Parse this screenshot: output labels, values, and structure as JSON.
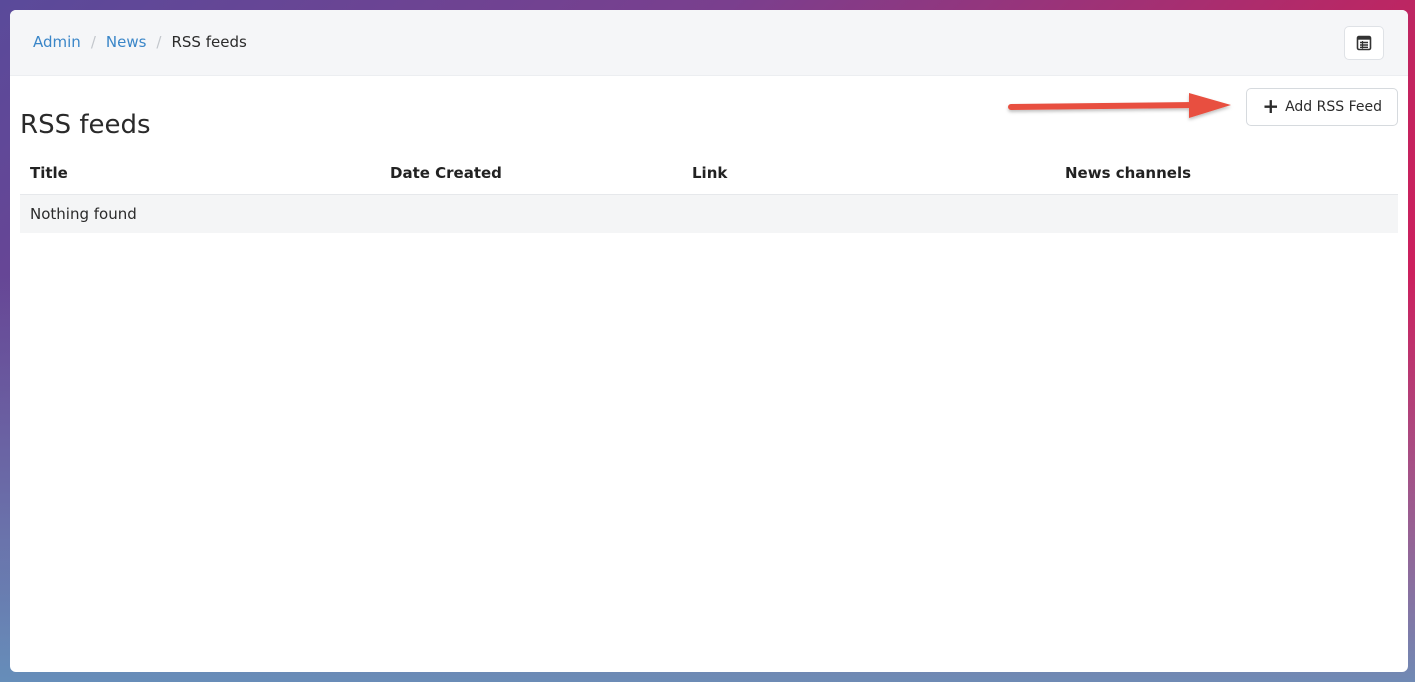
{
  "breadcrumb": {
    "items": [
      {
        "label": "Admin"
      },
      {
        "label": "News"
      }
    ],
    "current": "RSS feeds"
  },
  "page": {
    "title": "RSS feeds",
    "add_button_label": "Add RSS Feed"
  },
  "table": {
    "columns": [
      "Title",
      "Date Created",
      "Link",
      "News channels"
    ],
    "empty_message": "Nothing found"
  },
  "annotation": {
    "arrow_color": "#e8503f"
  }
}
